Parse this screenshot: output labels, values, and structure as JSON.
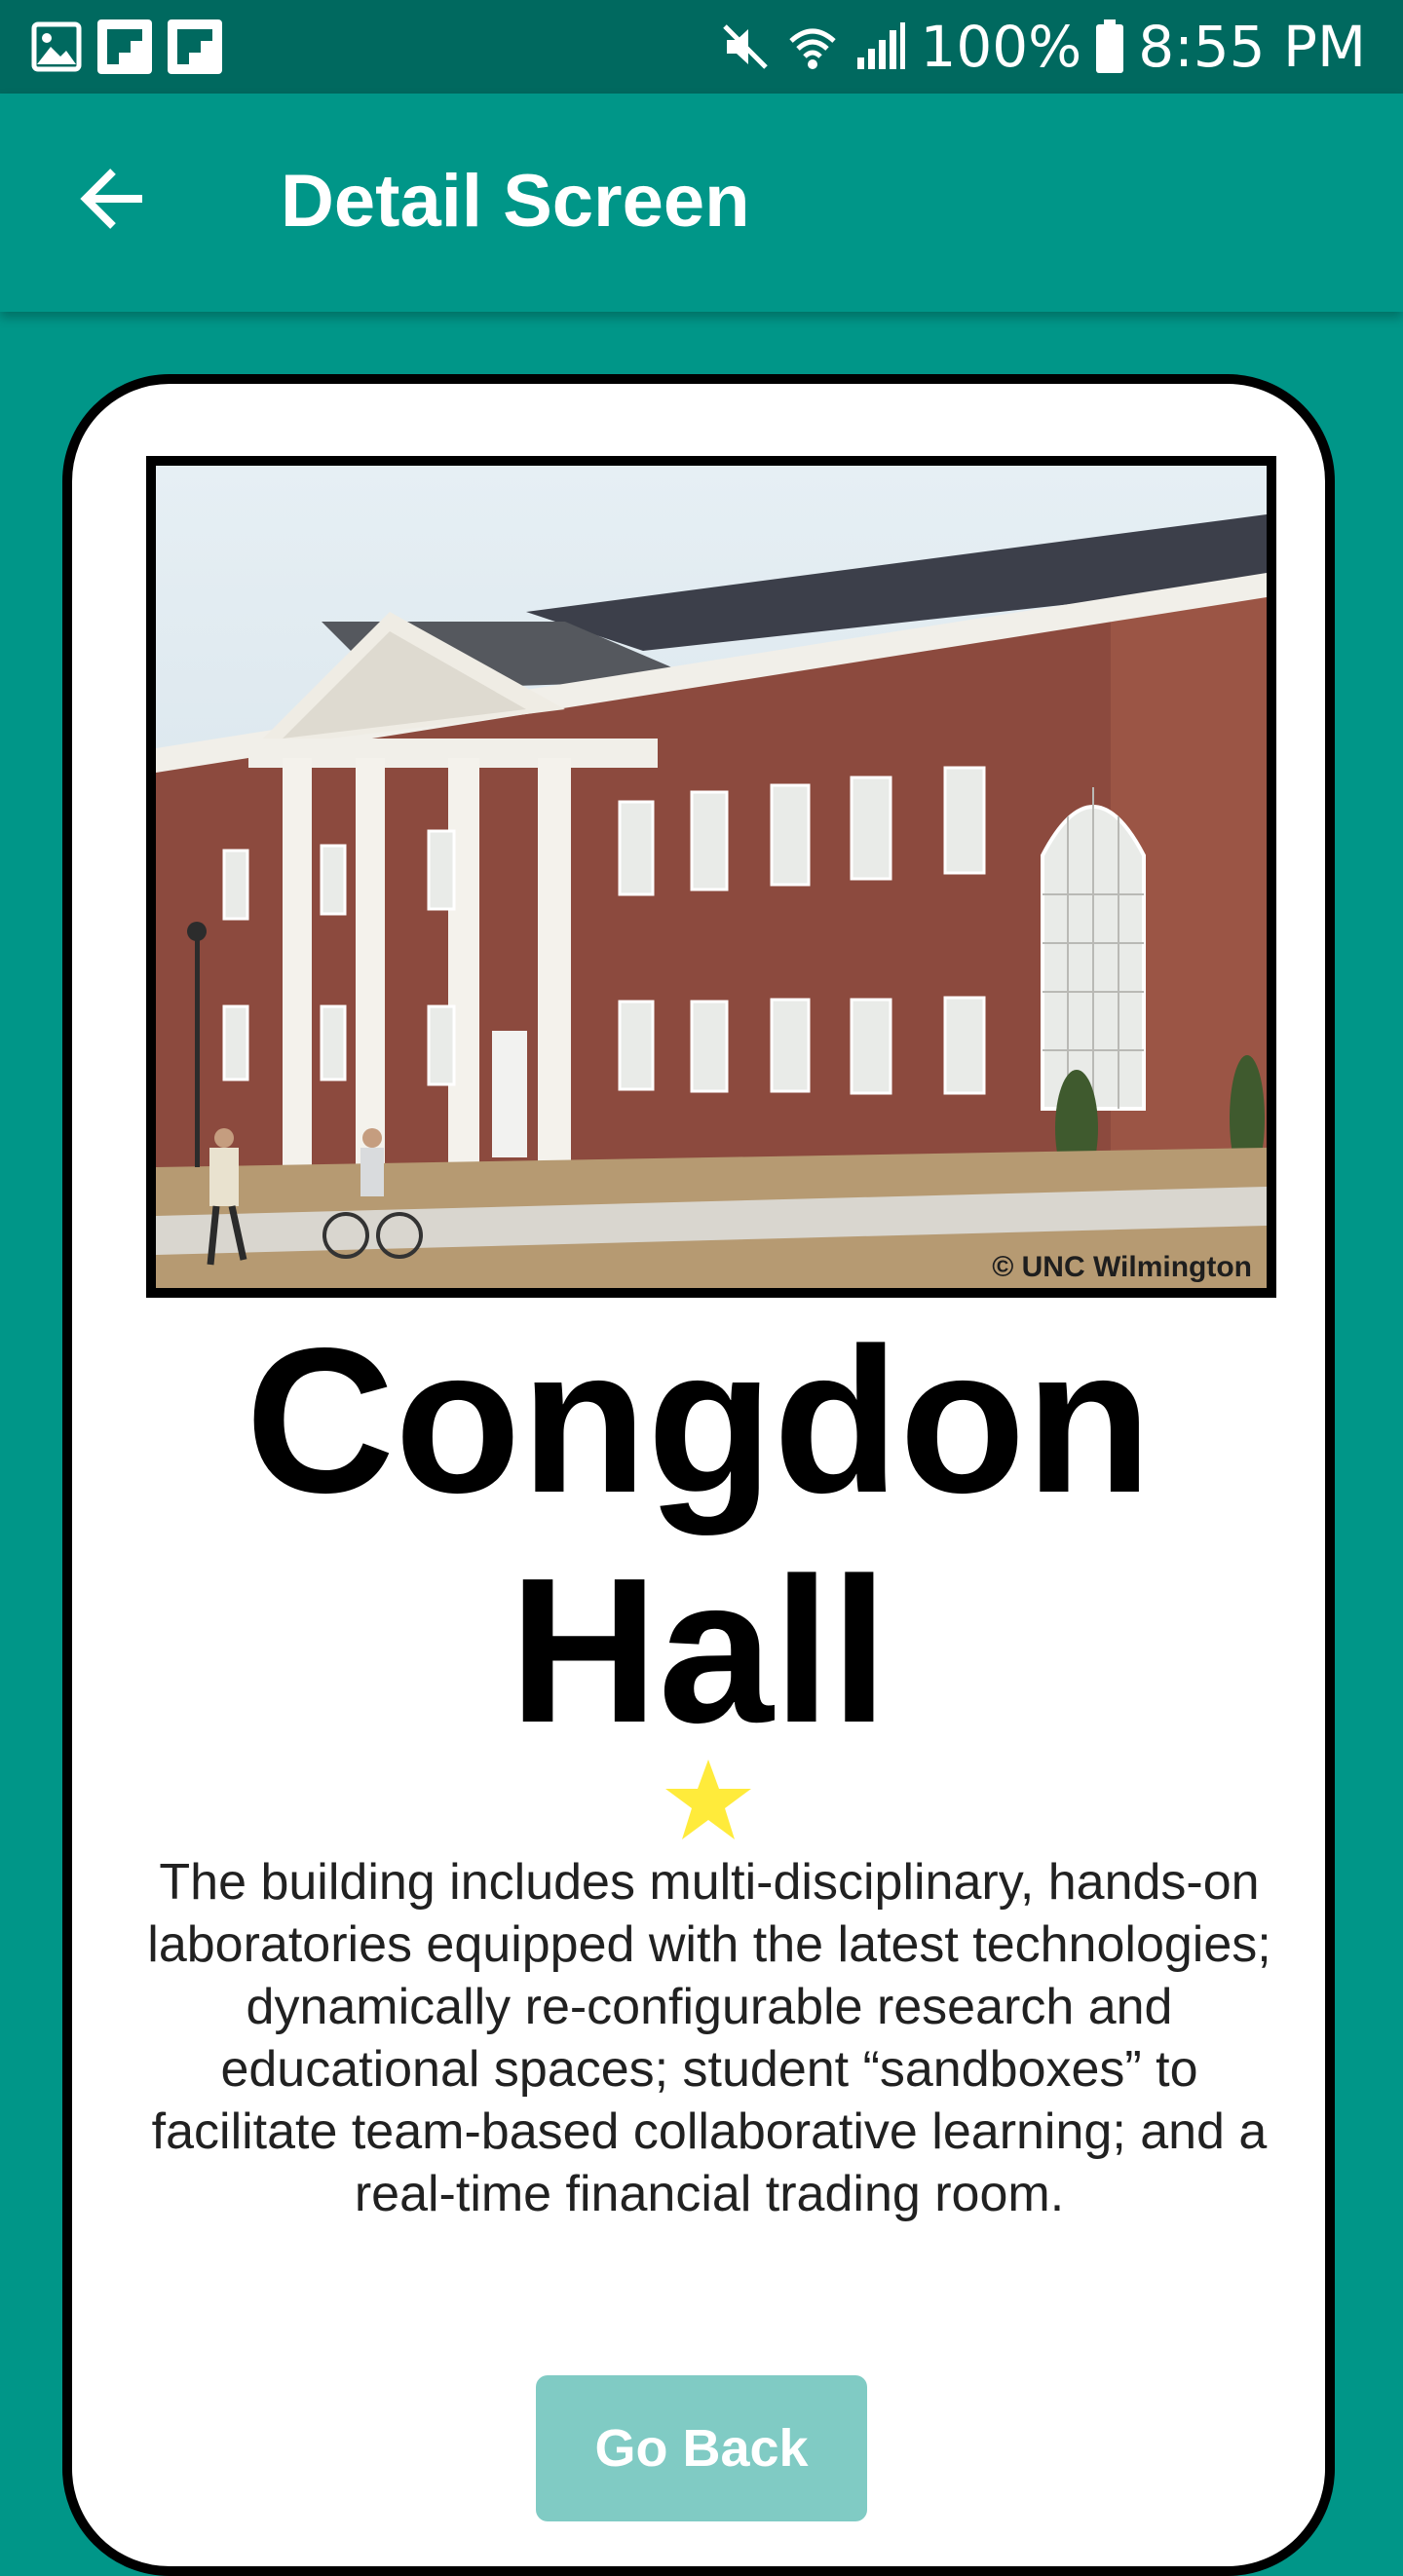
{
  "status_bar": {
    "notification_icons": [
      "image-icon",
      "flipboard-icon",
      "flipboard-icon"
    ],
    "system_icons": [
      "mute-icon",
      "wifi-icon",
      "signal-icon",
      "battery-icon"
    ],
    "battery_percent": "100%",
    "time": "8:55 PM"
  },
  "app_bar": {
    "back_icon": "arrow-back-icon",
    "title": "Detail Screen"
  },
  "detail": {
    "photo_caption": "© UNC Wilmington",
    "name": "Congdon Hall",
    "rating_icon": "star-icon",
    "rating_color": "#ffeb3b",
    "description": "The building includes multi-disciplinary, hands-on laboratories equipped with the latest technologies; dynamically re-configurable research and educational spaces; student “sandboxes” to facilitate team-based collaborative learning; and a real-time financial trading room.",
    "go_back_label": "Go Back"
  },
  "colors": {
    "primary": "#009688",
    "primary_dark": "#00695f",
    "button_disabled": "#80cbc4"
  }
}
